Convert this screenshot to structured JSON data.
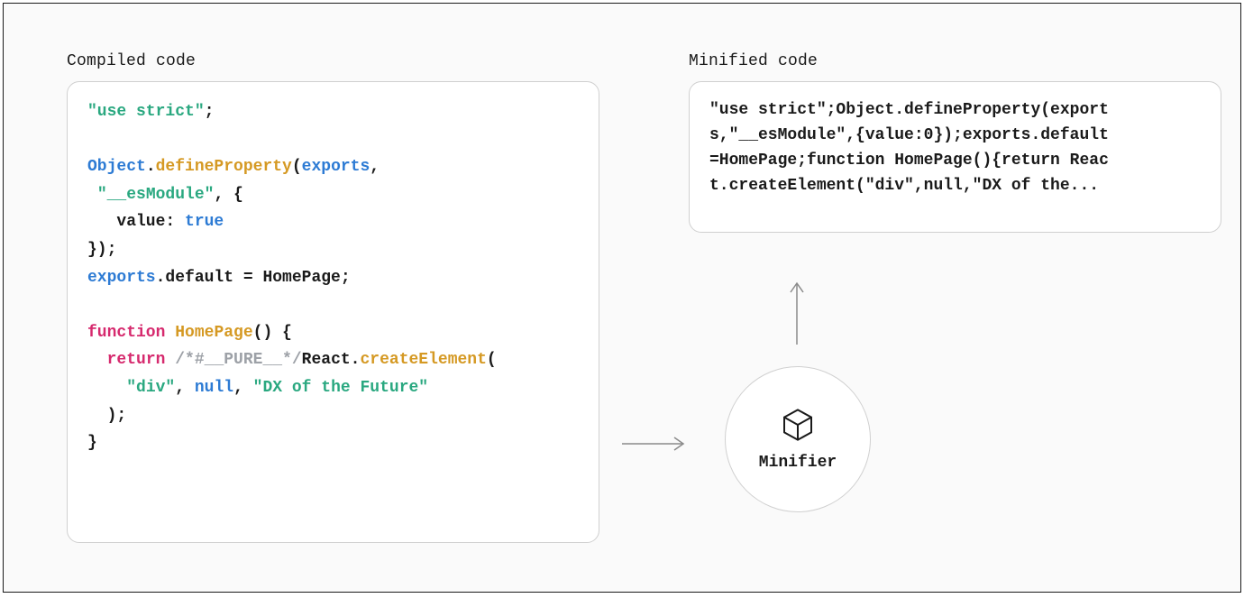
{
  "left_label": "Compiled code",
  "right_label": "Minified code",
  "minifier_label": "Minifier",
  "compiled_tokens": [
    [
      {
        "t": "\"use strict\"",
        "c": "s-str"
      },
      {
        "t": ";",
        "c": "s-def"
      }
    ],
    [],
    [
      {
        "t": "Object",
        "c": "s-cls"
      },
      {
        "t": ".",
        "c": "s-def"
      },
      {
        "t": "defineProperty",
        "c": "s-meth"
      },
      {
        "t": "(",
        "c": "s-def"
      },
      {
        "t": "exports",
        "c": "s-cls"
      },
      {
        "t": ",",
        "c": "s-def"
      }
    ],
    [
      {
        "t": " ",
        "c": "s-def"
      },
      {
        "t": "\"__esModule\"",
        "c": "s-str"
      },
      {
        "t": ", {",
        "c": "s-def"
      }
    ],
    [
      {
        "t": "   value: ",
        "c": "s-def"
      },
      {
        "t": "true",
        "c": "s-num"
      }
    ],
    [
      {
        "t": "});",
        "c": "s-def"
      }
    ],
    [
      {
        "t": "exports",
        "c": "s-cls"
      },
      {
        "t": ".default = HomePage;",
        "c": "s-def"
      }
    ],
    [],
    [
      {
        "t": "function",
        "c": "s-key"
      },
      {
        "t": " ",
        "c": "s-def"
      },
      {
        "t": "HomePage",
        "c": "s-name"
      },
      {
        "t": "() {",
        "c": "s-def"
      }
    ],
    [
      {
        "t": "  ",
        "c": "s-def"
      },
      {
        "t": "return",
        "c": "s-key"
      },
      {
        "t": " ",
        "c": "s-def"
      },
      {
        "t": "/*#__PURE__*/",
        "c": "s-cmt"
      },
      {
        "t": "React.",
        "c": "s-def"
      },
      {
        "t": "createElement",
        "c": "s-meth"
      },
      {
        "t": "(",
        "c": "s-def"
      }
    ],
    [
      {
        "t": "    ",
        "c": "s-def"
      },
      {
        "t": "\"div\"",
        "c": "s-str"
      },
      {
        "t": ", ",
        "c": "s-def"
      },
      {
        "t": "null",
        "c": "s-num"
      },
      {
        "t": ", ",
        "c": "s-def"
      },
      {
        "t": "\"DX of the Future\"",
        "c": "s-str"
      }
    ],
    [
      {
        "t": "  );",
        "c": "s-def"
      }
    ],
    [
      {
        "t": "}",
        "c": "s-def"
      }
    ]
  ],
  "minified_lines": [
    "\"use strict\";Object.defineProperty(export",
    "s,\"__esModule\",{value:0});exports.default",
    "=HomePage;function HomePage(){return Reac",
    "t.createElement(\"div\",null,\"DX of the..."
  ]
}
